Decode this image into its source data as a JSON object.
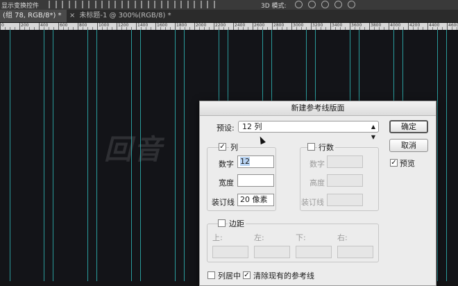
{
  "optionsbar": {
    "label": "显示变换控件",
    "mode3d": "3D 模式:"
  },
  "tabs": [
    {
      "label": "(组 78, RGB/8*) *"
    },
    {
      "close": "×",
      "label": "未标题-1 @ 300%(RGB/8) *"
    }
  ],
  "ruler": {
    "labels": [
      "0",
      "200",
      "400",
      "600",
      "800",
      "1000",
      "1200",
      "1400",
      "1600",
      "1800",
      "2000",
      "2200",
      "2400",
      "2600",
      "2800",
      "3000",
      "3200",
      "3400",
      "3600",
      "3800",
      "4000",
      "4200",
      "4400",
      "4600"
    ]
  },
  "dialog": {
    "title": "新建参考线版面",
    "preset_label": "预设:",
    "preset_value": "12 列",
    "ok": "确定",
    "cancel": "取消",
    "preview": "预览",
    "columns": {
      "label": "列",
      "number_label": "数字",
      "number_value": "12",
      "width_label": "宽度",
      "width_value": "",
      "gutter_label": "装订线",
      "gutter_value": "20 像素"
    },
    "rows": {
      "label": "行数",
      "number_label": "数字",
      "height_label": "高度",
      "gutter_label": "装订线"
    },
    "margin": {
      "label": "边距",
      "top": "上:",
      "left": "左:",
      "bottom": "下:",
      "right": "右:"
    },
    "center_columns": "列居中",
    "clear_guides": "清除现有的参考线"
  },
  "colors": {
    "guide": "#2fb4b4",
    "canvas": "#131418",
    "dialog": "#ececec"
  }
}
